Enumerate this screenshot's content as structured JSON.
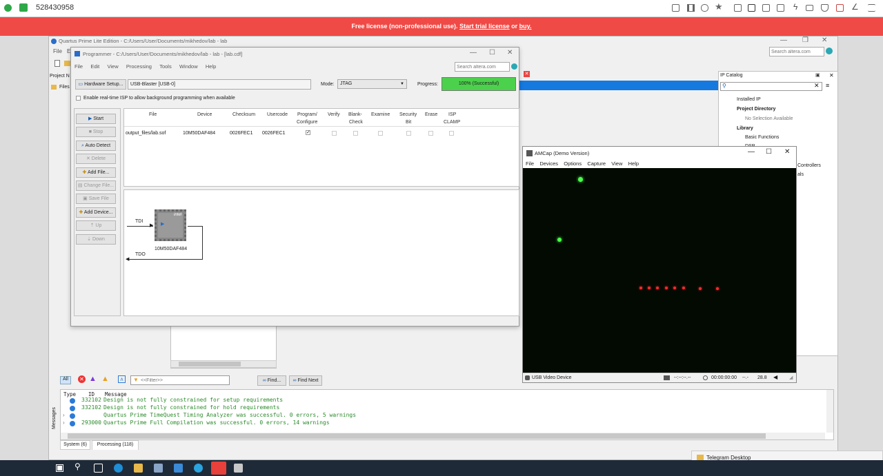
{
  "remote": {
    "session_id": "528430958"
  },
  "banner": {
    "text": "Free license (non-professional use).",
    "trial": "Start trial license",
    "or": "or",
    "buy": "buy."
  },
  "quartus": {
    "title": "Quartus Prime Lite Edition - C:/Users/User/Documents/mikhedov/lab - lab",
    "menu_file": "File",
    "menu_e": "E",
    "search_placeholder": "Search altera.com",
    "project_nav": "Project N",
    "files": "Files",
    "ip_catalog": {
      "title": "IP Catalog",
      "installed": "Installed IP",
      "project_dir": "Project Directory",
      "no_selection": "No Selection Available",
      "library": "Library",
      "basic": "Basic Functions",
      "dsp": "DSP",
      "partial1": "Controllers",
      "partial2": "als"
    }
  },
  "programmer": {
    "title": "Programmer - C:/Users/User/Documents/mikhedov/lab - lab - [lab.cdf]",
    "menu": [
      "File",
      "Edit",
      "View",
      "Processing",
      "Tools",
      "Window",
      "Help"
    ],
    "search_placeholder": "Search altera.com",
    "hw_setup": "Hardware Setup...",
    "hw_value": "USB-Blaster [USB-0]",
    "mode_label": "Mode:",
    "mode_value": "JTAG",
    "progress_label": "Progress:",
    "progress_text": "100% (Successful)",
    "progress": 1.0,
    "isp_label": "Enable real-time ISP to allow background programming when available",
    "buttons": {
      "start": "Start",
      "stop": "Stop",
      "auto_detect": "Auto Detect",
      "delete": "Delete",
      "add_file": "Add File...",
      "change_file": "Change File...",
      "save_file": "Save File",
      "add_device": "Add Device...",
      "up": "Up",
      "down": "Down"
    },
    "columns": {
      "file": "File",
      "device": "Device",
      "checksum": "Checksum",
      "usercode": "Usercode",
      "program1": "Program/",
      "program2": "Configure",
      "verify": "Verify",
      "blank1": "Blank-",
      "blank2": "Check",
      "examine": "Examine",
      "security1": "Security",
      "security2": "Bit",
      "erase": "Erase",
      "isp1": "ISP",
      "isp2": "CLAMP"
    },
    "row": {
      "file": "output_files/lab.sof",
      "device": "10M50DAF484",
      "checksum": "0026FEC1",
      "usercode": "0026FEC1"
    },
    "chain": {
      "tdi": "TDI",
      "tdo": "TDO",
      "chip": "10M50DAF484",
      "brand": "intel"
    }
  },
  "amcap": {
    "title": "AMCap (Demo Version)",
    "menu": [
      "File",
      "Devices",
      "Options",
      "Capture",
      "View",
      "Help"
    ],
    "status_device": "USB Video Device",
    "status_time1": "--:--:--.--",
    "status_time2": "00:00:00:00",
    "status_dash": "--.-",
    "status_fps": "28.8"
  },
  "messages": {
    "filter_placeholder": "<<Filter>>",
    "find": "Find...",
    "find_next": "Find Next",
    "all": "All",
    "col_type": "Type",
    "col_id": "ID",
    "col_message": "Message",
    "lines": [
      {
        "id": "332102",
        "text": "Design is not fully constrained for setup requirements"
      },
      {
        "id": "332102",
        "text": "Design is not fully constrained for hold requirements"
      },
      {
        "id": "",
        "text": "Quartus Prime TimeQuest Timing Analyzer was successful. 0 errors, 5 warnings"
      },
      {
        "id": "293000",
        "text": "Quartus Prime Full Compilation was successful. 0 errors, 14 warnings"
      }
    ],
    "tab_system": "System (6)",
    "tab_processing": "Processing (118)",
    "side_label": "Messages"
  },
  "telegram": {
    "label": "Telegram Desktop"
  },
  "colors": {
    "banner": "#f04a46",
    "progress": "#4cd14c",
    "led_green": "#4cff4c",
    "led_red": "#ff2a2a",
    "taskbar": "#1f2a38"
  }
}
